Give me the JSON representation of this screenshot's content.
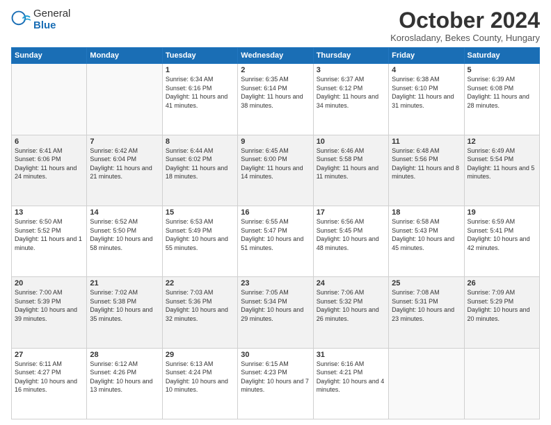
{
  "logo": {
    "general": "General",
    "blue": "Blue"
  },
  "header": {
    "month": "October 2024",
    "location": "Korosladany, Bekes County, Hungary"
  },
  "weekdays": [
    "Sunday",
    "Monday",
    "Tuesday",
    "Wednesday",
    "Thursday",
    "Friday",
    "Saturday"
  ],
  "weeks": [
    [
      {
        "day": "",
        "info": ""
      },
      {
        "day": "",
        "info": ""
      },
      {
        "day": "1",
        "info": "Sunrise: 6:34 AM\nSunset: 6:16 PM\nDaylight: 11 hours and 41 minutes."
      },
      {
        "day": "2",
        "info": "Sunrise: 6:35 AM\nSunset: 6:14 PM\nDaylight: 11 hours and 38 minutes."
      },
      {
        "day": "3",
        "info": "Sunrise: 6:37 AM\nSunset: 6:12 PM\nDaylight: 11 hours and 34 minutes."
      },
      {
        "day": "4",
        "info": "Sunrise: 6:38 AM\nSunset: 6:10 PM\nDaylight: 11 hours and 31 minutes."
      },
      {
        "day": "5",
        "info": "Sunrise: 6:39 AM\nSunset: 6:08 PM\nDaylight: 11 hours and 28 minutes."
      }
    ],
    [
      {
        "day": "6",
        "info": "Sunrise: 6:41 AM\nSunset: 6:06 PM\nDaylight: 11 hours and 24 minutes."
      },
      {
        "day": "7",
        "info": "Sunrise: 6:42 AM\nSunset: 6:04 PM\nDaylight: 11 hours and 21 minutes."
      },
      {
        "day": "8",
        "info": "Sunrise: 6:44 AM\nSunset: 6:02 PM\nDaylight: 11 hours and 18 minutes."
      },
      {
        "day": "9",
        "info": "Sunrise: 6:45 AM\nSunset: 6:00 PM\nDaylight: 11 hours and 14 minutes."
      },
      {
        "day": "10",
        "info": "Sunrise: 6:46 AM\nSunset: 5:58 PM\nDaylight: 11 hours and 11 minutes."
      },
      {
        "day": "11",
        "info": "Sunrise: 6:48 AM\nSunset: 5:56 PM\nDaylight: 11 hours and 8 minutes."
      },
      {
        "day": "12",
        "info": "Sunrise: 6:49 AM\nSunset: 5:54 PM\nDaylight: 11 hours and 5 minutes."
      }
    ],
    [
      {
        "day": "13",
        "info": "Sunrise: 6:50 AM\nSunset: 5:52 PM\nDaylight: 11 hours and 1 minute."
      },
      {
        "day": "14",
        "info": "Sunrise: 6:52 AM\nSunset: 5:50 PM\nDaylight: 10 hours and 58 minutes."
      },
      {
        "day": "15",
        "info": "Sunrise: 6:53 AM\nSunset: 5:49 PM\nDaylight: 10 hours and 55 minutes."
      },
      {
        "day": "16",
        "info": "Sunrise: 6:55 AM\nSunset: 5:47 PM\nDaylight: 10 hours and 51 minutes."
      },
      {
        "day": "17",
        "info": "Sunrise: 6:56 AM\nSunset: 5:45 PM\nDaylight: 10 hours and 48 minutes."
      },
      {
        "day": "18",
        "info": "Sunrise: 6:58 AM\nSunset: 5:43 PM\nDaylight: 10 hours and 45 minutes."
      },
      {
        "day": "19",
        "info": "Sunrise: 6:59 AM\nSunset: 5:41 PM\nDaylight: 10 hours and 42 minutes."
      }
    ],
    [
      {
        "day": "20",
        "info": "Sunrise: 7:00 AM\nSunset: 5:39 PM\nDaylight: 10 hours and 39 minutes."
      },
      {
        "day": "21",
        "info": "Sunrise: 7:02 AM\nSunset: 5:38 PM\nDaylight: 10 hours and 35 minutes."
      },
      {
        "day": "22",
        "info": "Sunrise: 7:03 AM\nSunset: 5:36 PM\nDaylight: 10 hours and 32 minutes."
      },
      {
        "day": "23",
        "info": "Sunrise: 7:05 AM\nSunset: 5:34 PM\nDaylight: 10 hours and 29 minutes."
      },
      {
        "day": "24",
        "info": "Sunrise: 7:06 AM\nSunset: 5:32 PM\nDaylight: 10 hours and 26 minutes."
      },
      {
        "day": "25",
        "info": "Sunrise: 7:08 AM\nSunset: 5:31 PM\nDaylight: 10 hours and 23 minutes."
      },
      {
        "day": "26",
        "info": "Sunrise: 7:09 AM\nSunset: 5:29 PM\nDaylight: 10 hours and 20 minutes."
      }
    ],
    [
      {
        "day": "27",
        "info": "Sunrise: 6:11 AM\nSunset: 4:27 PM\nDaylight: 10 hours and 16 minutes."
      },
      {
        "day": "28",
        "info": "Sunrise: 6:12 AM\nSunset: 4:26 PM\nDaylight: 10 hours and 13 minutes."
      },
      {
        "day": "29",
        "info": "Sunrise: 6:13 AM\nSunset: 4:24 PM\nDaylight: 10 hours and 10 minutes."
      },
      {
        "day": "30",
        "info": "Sunrise: 6:15 AM\nSunset: 4:23 PM\nDaylight: 10 hours and 7 minutes."
      },
      {
        "day": "31",
        "info": "Sunrise: 6:16 AM\nSunset: 4:21 PM\nDaylight: 10 hours and 4 minutes."
      },
      {
        "day": "",
        "info": ""
      },
      {
        "day": "",
        "info": ""
      }
    ]
  ]
}
